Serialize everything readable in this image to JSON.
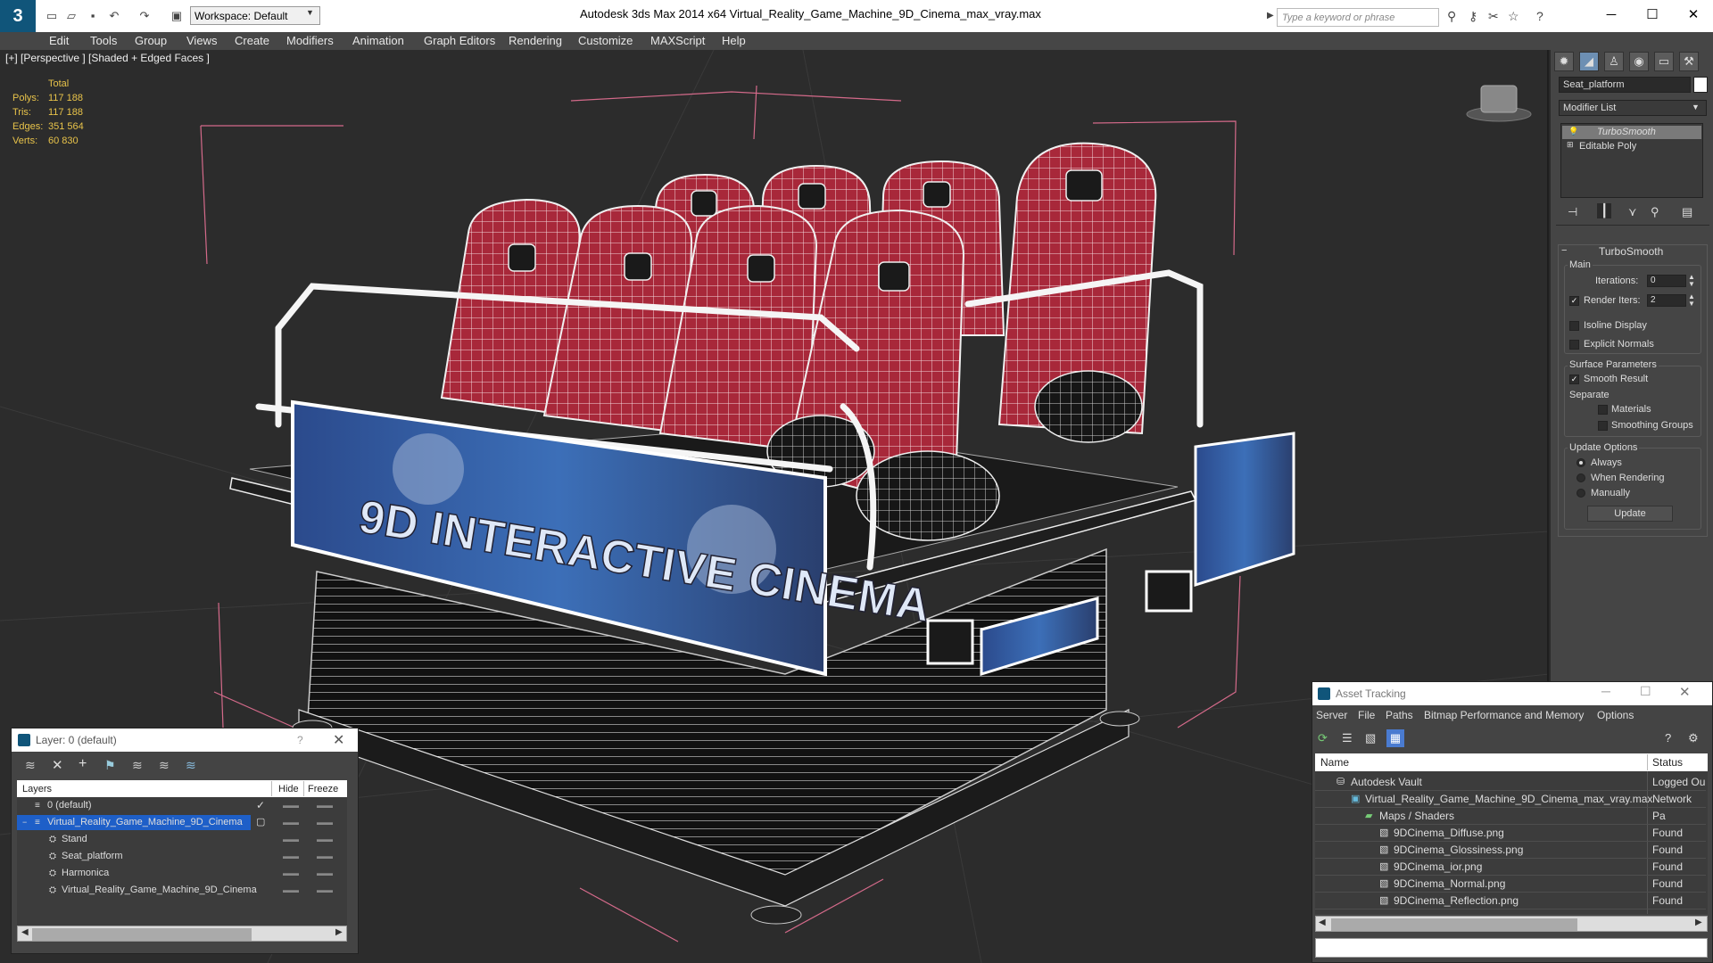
{
  "window": {
    "title": "Autodesk 3ds Max  2014 x64      Virtual_Reality_Game_Machine_9D_Cinema_max_vray.max",
    "workspace": "Workspace: Default",
    "search_placeholder": "Type a keyword or phrase"
  },
  "menu": [
    "Edit",
    "Tools",
    "Group",
    "Views",
    "Create",
    "Modifiers",
    "Animation",
    "Graph Editors",
    "Rendering",
    "Customize",
    "MAXScript",
    "Help"
  ],
  "viewport": {
    "label": "[+] [Perspective ] [Shaded + Edged Faces ]",
    "stats": {
      "header": "Total",
      "rows": [
        {
          "label": "Polys:",
          "value": "117 188"
        },
        {
          "label": "Tris:",
          "value": "117 188"
        },
        {
          "label": "Edges:",
          "value": "351 564"
        },
        {
          "label": "Verts:",
          "value": "60 830"
        }
      ]
    },
    "banner_text": "9D INTERACTIVE CINEMA"
  },
  "command_panel": {
    "object_name": "Seat_platform",
    "modifier_list_label": "Modifier List",
    "stack": [
      "TurboSmooth",
      "Editable Poly"
    ],
    "rollout_title": "TurboSmooth",
    "main_group": "Main",
    "iterations_label": "Iterations:",
    "iterations_value": "0",
    "render_iters_label": "Render Iters:",
    "render_iters_value": "2",
    "isoline_label": "Isoline Display",
    "explicit_normals_label": "Explicit Normals",
    "surface_group": "Surface Parameters",
    "smooth_result_label": "Smooth Result",
    "separate_label": "Separate",
    "materials_label": "Materials",
    "smoothing_groups_label": "Smoothing Groups",
    "update_group": "Update Options",
    "always_label": "Always",
    "when_rendering_label": "When Rendering",
    "manually_label": "Manually",
    "update_button": "Update"
  },
  "layer_dialog": {
    "title": "Layer: 0 (default)",
    "help": "?",
    "columns": [
      "Layers",
      "Hide",
      "Freeze"
    ],
    "rows": [
      {
        "name": "0 (default)",
        "indent": 0,
        "selected": false,
        "checked": true
      },
      {
        "name": "Virtual_Reality_Game_Machine_9D_Cinema",
        "indent": 0,
        "selected": true,
        "checked": false
      },
      {
        "name": "Stand",
        "indent": 1,
        "selected": false,
        "checked": false
      },
      {
        "name": "Seat_platform",
        "indent": 1,
        "selected": false,
        "checked": false
      },
      {
        "name": "Harmonica",
        "indent": 1,
        "selected": false,
        "checked": false
      },
      {
        "name": "Virtual_Reality_Game_Machine_9D_Cinema",
        "indent": 1,
        "selected": false,
        "checked": false
      }
    ]
  },
  "asset_dialog": {
    "title": "Asset Tracking",
    "menu": [
      "Server",
      "File",
      "Paths",
      "Bitmap Performance and Memory",
      "Options"
    ],
    "columns": [
      "Name",
      "Status"
    ],
    "rows": [
      {
        "name": "Autodesk Vault",
        "status": "Logged Ou",
        "indent": 1
      },
      {
        "name": "Virtual_Reality_Game_Machine_9D_Cinema_max_vray.max",
        "status": "Network Pa",
        "indent": 2
      },
      {
        "name": "Maps / Shaders",
        "status": "",
        "indent": 3
      },
      {
        "name": "9DCinema_Diffuse.png",
        "status": "Found",
        "indent": 4
      },
      {
        "name": "9DCinema_Glossiness.png",
        "status": "Found",
        "indent": 4
      },
      {
        "name": "9DCinema_ior.png",
        "status": "Found",
        "indent": 4
      },
      {
        "name": "9DCinema_Normal.png",
        "status": "Found",
        "indent": 4
      },
      {
        "name": "9DCinema_Reflection.png",
        "status": "Found",
        "indent": 4
      }
    ]
  },
  "colors": {
    "accent": "#10557a",
    "selection": "#1e5fc8",
    "stats": "#e8c34a",
    "seat_red": "#b0283a"
  }
}
